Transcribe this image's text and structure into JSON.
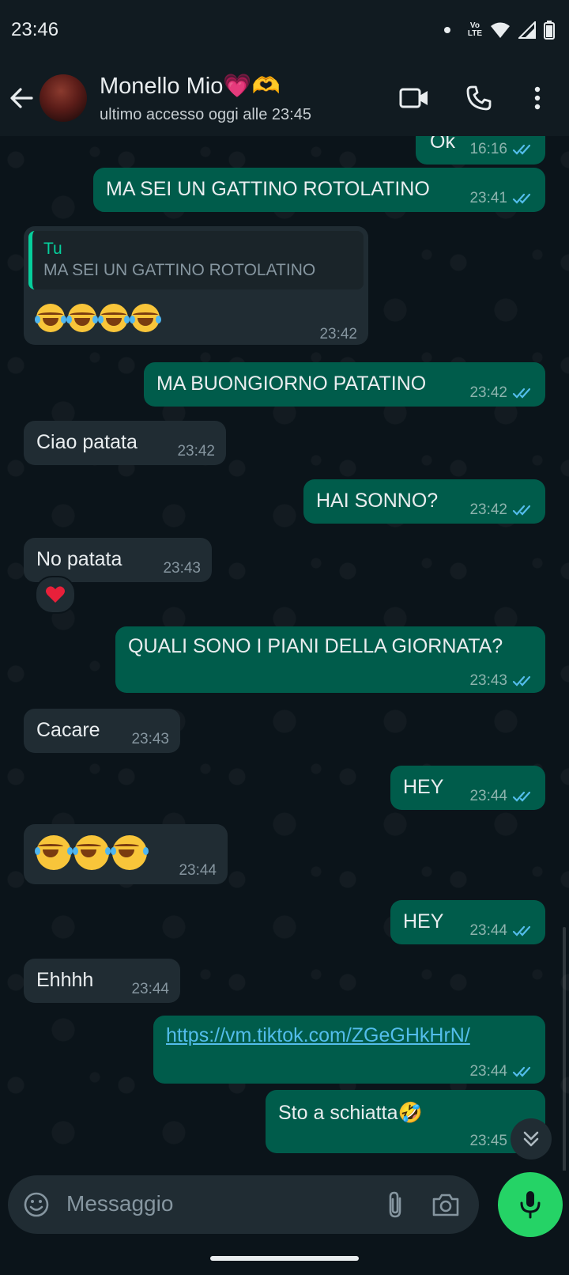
{
  "status_bar": {
    "time": "23:46",
    "network": "Vo LTE"
  },
  "header": {
    "contact_name": "Monello Mio💗🫶",
    "last_seen": "ultimo accesso oggi alle 23:45"
  },
  "messages": [
    {
      "dir": "out",
      "text": "Ok",
      "time": "16:16",
      "read": true
    },
    {
      "dir": "out",
      "text": "MA SEI UN GATTINO ROTOLATINO",
      "time": "23:41",
      "read": true
    },
    {
      "dir": "in",
      "quote_author": "Tu",
      "quote_text": "MA SEI UN GATTINO ROTOLATINO",
      "text": "😂😂😂😂",
      "time": "23:42"
    },
    {
      "dir": "out",
      "text": "MA BUONGIORNO PATATINO",
      "time": "23:42",
      "read": true
    },
    {
      "dir": "in",
      "text": "Ciao patata",
      "time": "23:42"
    },
    {
      "dir": "out",
      "text": "HAI SONNO?",
      "time": "23:42",
      "read": true
    },
    {
      "dir": "in",
      "text": "No patata",
      "time": "23:43",
      "reaction": "❤️"
    },
    {
      "dir": "out",
      "text": "QUALI SONO I PIANI DELLA GIORNATA?",
      "time": "23:43",
      "read": true
    },
    {
      "dir": "in",
      "text": "Cacare",
      "time": "23:43"
    },
    {
      "dir": "out",
      "text": "HEY",
      "time": "23:44",
      "read": true
    },
    {
      "dir": "in",
      "text": "😂😂😂",
      "time": "23:44"
    },
    {
      "dir": "out",
      "text": "HEY",
      "time": "23:44",
      "read": true
    },
    {
      "dir": "in",
      "text": "Ehhhh",
      "time": "23:44"
    },
    {
      "dir": "out",
      "text": "https://vm.tiktok.com/ZGeGHkHrN/",
      "time": "23:44",
      "read": true
    },
    {
      "dir": "out",
      "text": "Sto a schiatta🤣",
      "time": "23:45",
      "read": true
    }
  ],
  "composer": {
    "placeholder": "Messaggio"
  },
  "colors": {
    "outgoing_bubble": "#005c4b",
    "incoming_bubble": "#202c33",
    "accent": "#25d366",
    "read_ticks": "#53bdeb"
  }
}
